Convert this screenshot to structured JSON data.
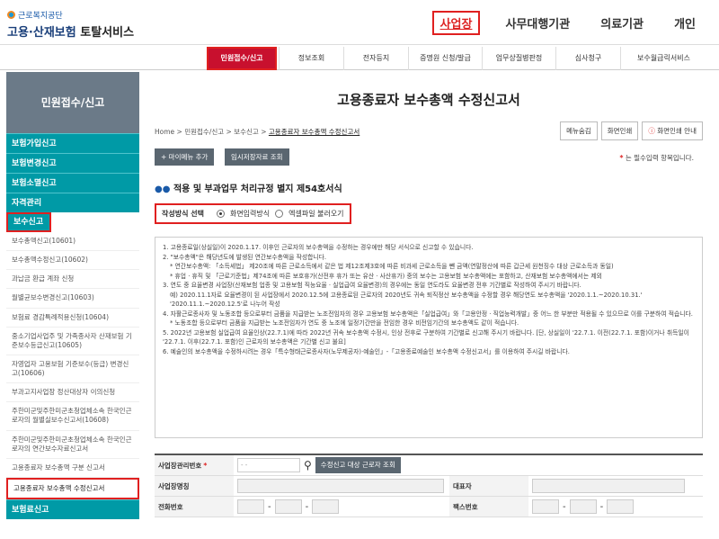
{
  "logo": {
    "org": "근로복지공단",
    "service_main": "고용·산재보험",
    "service_sub": "토탈서비스"
  },
  "topnav": [
    "사업장",
    "사무대행기관",
    "의료기관",
    "개인"
  ],
  "menu": [
    "민원접수/신고",
    "정보조회",
    "전자등지",
    "증명원 신청/발급",
    "업무상질병판정",
    "심사청구",
    "보수월급릭서비스"
  ],
  "sidebar": {
    "title": "민원접수/신고",
    "groups_top": [
      "보험가입신고",
      "보험변경신고",
      "보험소멸신고",
      "자격관리",
      "보수신고"
    ],
    "items": [
      "보수총액신고(10601)",
      "보수총액수정신고(10602)",
      "과납금 환급 계좌 신청",
      "월별균보수변경신고(10603)",
      "보험료 경감특례적용신청(10604)",
      "중소기업사업주 및 가족종사자 산재보험 기준보수등급신고(10605)",
      "자영업자 고용보험 기준보수(등급) 변경신고(10606)",
      "부과고지사업장 정산대상자 이의신청",
      "주한미군및주한미군초청업체소속 한국인근로자의 월별실보수신고서(10608)",
      "주한미군및주한미군초청업체소속 한국인근로자의 연간보수자료신고서",
      "고용종료자 보수총액 구분 신고서",
      "고용종료자 보수총액 수정신고서"
    ],
    "group_bottom": "보험료신고"
  },
  "main": {
    "title": "고용종료자 보수총액 수정신고서",
    "breadcrumb": [
      "Home",
      "민원접수/신고",
      "보수신고",
      "고용종료자 보수총액 수정신고서"
    ],
    "top_buttons": [
      "메뉴숨김",
      "화면인쇄",
      "화면인쇄 안내"
    ],
    "btn_add": "+ 마이메뉴 추가",
    "btn_temp": "임시저장자료 조회",
    "required_note": "는 필수입력 항목입니다.",
    "section_title": "적용 및 부과업무 처리규정 별지 제54호서식",
    "method_label": "작성방식 선택",
    "method_options": [
      "화면입력방식",
      "엑셀파일 불러오기"
    ],
    "notices": [
      "1. 고용종료일(상실일)이 2020.1.17. 이후인 근로자의 보수총액을 수정하는 경우에만 해당 서식으로 신고할 수 있습니다.",
      "2. \"보수총액\"은 해당년도에 발생된 연간보수총액을 작성합니다.",
      " * 연간보수총액: 「소득세법」 제20조에 따른 근로소득에서 같은 법 제12조제3호에 따른 비과세 근로소득을 뺀 금액(연말정산에 따른 갑근세 원천징수 대상 근로소득과 동일)",
      " * 휴업 · 휴직 및 「근로기준법」제74조에 따른 보호휴가(산전후 휴가 또는 유산 · 사산휴가) 중의 보수는 고용보험 보수총액에는 포함하고, 산재보험 보수총액에서는 제외",
      "3. 연도 중 요율변경 사업장(산재보험 업종 및 고용보험 직능요율 · 실업급여 요율변경)의 경우에는 동일 연도라도 요율변경 전후 기간별로 작성하여 주시기 바랍니다.",
      " 예) 2020.11.1자로 요율변경이 된 사업장에서 2020.12.5에 고용종료된 근로자의 2020년도 귀속 퇴직정산 보수총액을 수정할 경우 해당연도 보수총액을 '2020.1.1.~2020.10.31.' '2020.11.1.~2020.12.5'로 나누어 작성",
      "4. 자활근로종사자 및 노동조합 등으로부터 금품을 지급받는 노조전임자의 경우 고용보험 보수총액은「실업급여」와「고용안정 · 직업능력개발」중 어느 한 부분만 적용될 수 있으므로 이를 구분하여 적습니다.",
      " * 노동조합 등으로부터 금품을 지급받는 노조전임자가 연도 중 노조에 일정기간만을 전임한 경우 비전임기간의 보수총액도 같이 적습니다.",
      "5. 2022년 고용보험 실업급여 요율인상(22.7.1)에 따라 2022년 귀속 보수총액 수정시, 인상 전후로 구분하여 기간별로 신고해 주시기 바랍니다. [단, 상실일이 '22.7.1. 이전(22.7.1. 포함)이거나 취득일이 '22.7.1. 이후(22.7.1. 포함)인 근로자의 보수총액은 기간별 신고 불요]",
      "6. 예술인의 보수총액을 수정하시려는 경우「특수형태근로종사자(노무제공자)·예술인」-「고용종료예술인 보수총액 수정신고서」를 이용하여 주시길 바랍니다."
    ]
  },
  "form": {
    "biz_no_label": "사업장관리번호",
    "biz_no_placeholder": "- -",
    "btn_lookup": "수정신고 대상 근로자 조회",
    "biz_name_label": "사업장명칭",
    "rep_label": "대표자",
    "phone_label": "전화번호",
    "fax_label": "팩스번호"
  }
}
